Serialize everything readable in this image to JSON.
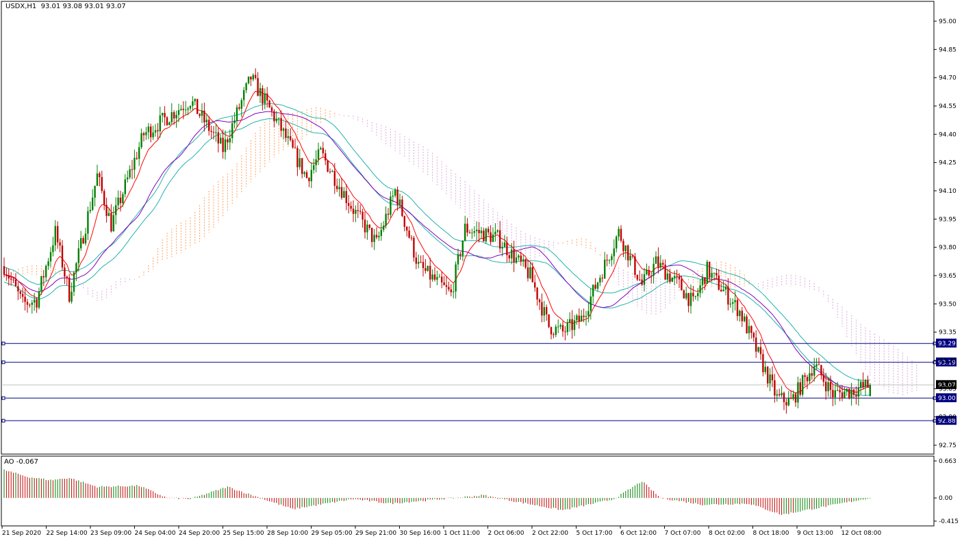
{
  "header": {
    "symbol_text": "USDX,H1  93.01 93.08 93.01 93.07"
  },
  "indicator": {
    "label": "AO -0.067",
    "y_ticks": [
      "0.663",
      "0.00",
      "-0.415"
    ],
    "range": [
      -0.415,
      0.663
    ]
  },
  "price_axis": {
    "ticks": [
      "95.00",
      "94.85",
      "94.70",
      "94.55",
      "94.40",
      "94.25",
      "94.10",
      "93.95",
      "93.80",
      "93.65",
      "93.50",
      "93.35",
      "93.20",
      "93.05",
      "92.90",
      "92.75"
    ],
    "range": [
      92.75,
      95.0
    ]
  },
  "time_axis": {
    "labels": [
      "21 Sep 2020",
      "22 Sep 14:00",
      "23 Sep 09:00",
      "24 Sep 04:00",
      "24 Sep 20:00",
      "25 Sep 15:00",
      "28 Sep 10:00",
      "29 Sep 05:00",
      "29 Sep 21:00",
      "30 Sep 16:00",
      "1 Oct 11:00",
      "2 Oct 06:00",
      "2 Oct 22:00",
      "5 Oct 17:00",
      "6 Oct 12:00",
      "7 Oct 07:00",
      "8 Oct 02:00",
      "8 Oct 18:00",
      "9 Oct 13:00",
      "12 Oct 08:00"
    ]
  },
  "levels": [
    {
      "label": "93.29",
      "value": 93.29
    },
    {
      "label": "93.19",
      "value": 93.19
    },
    {
      "label": "93.00",
      "value": 93.0
    },
    {
      "label": "92.88",
      "value": 92.88
    }
  ],
  "current_price": {
    "label": "93.07",
    "value": 93.07
  },
  "colors": {
    "bull": "#008000",
    "bear": "#c00000",
    "level_line": "#000080",
    "level_tag_bg": "#000080",
    "ma_fast": "#ff0000",
    "ma_slow": "#8000c0",
    "ma_band": "#20b2aa",
    "cloud_bull": "#ff8c40",
    "cloud_bear": "#d59ad5",
    "grid": "#000000"
  },
  "chart_data": {
    "type": "candlestick",
    "title": "USDX,H1",
    "ohlc_last": {
      "open": 93.01,
      "high": 93.08,
      "low": 93.01,
      "close": 93.07
    },
    "ylim": [
      92.75,
      95.0
    ],
    "levels": [
      93.29,
      93.19,
      93.0,
      92.88
    ],
    "anchors_t": [
      0,
      8,
      14,
      22,
      28,
      40,
      46,
      60,
      80,
      94,
      106,
      118,
      130,
      136,
      150,
      160,
      168,
      178,
      192,
      198,
      212,
      226,
      234,
      240,
      248,
      264,
      274,
      280,
      290,
      296,
      302,
      316,
      332,
      338,
      348,
      356,
      364,
      372
    ],
    "anchors_p": [
      93.7,
      93.5,
      93.52,
      93.88,
      93.55,
      94.18,
      93.92,
      94.4,
      94.58,
      94.32,
      94.7,
      94.45,
      94.17,
      94.3,
      94.0,
      93.82,
      94.1,
      93.7,
      93.55,
      93.9,
      93.85,
      93.65,
      93.38,
      93.35,
      93.42,
      93.88,
      93.6,
      93.72,
      93.6,
      93.5,
      93.68,
      93.46,
      93.0,
      92.98,
      93.18,
      93.02,
      93.04,
      93.07
    ],
    "ao_t": [
      0,
      10,
      20,
      28,
      40,
      58,
      70,
      80,
      96,
      110,
      124,
      150,
      166,
      188,
      206,
      214,
      240,
      262,
      274,
      282,
      300,
      320,
      334,
      352,
      372
    ],
    "ao_v": [
      0.5,
      0.38,
      0.32,
      0.36,
      0.2,
      0.22,
      0.0,
      -0.02,
      0.2,
      0.0,
      -0.2,
      -0.02,
      -0.1,
      -0.02,
      0.05,
      -0.02,
      -0.22,
      -0.02,
      0.3,
      0.0,
      -0.12,
      -0.1,
      -0.3,
      -0.16,
      0.0
    ]
  }
}
